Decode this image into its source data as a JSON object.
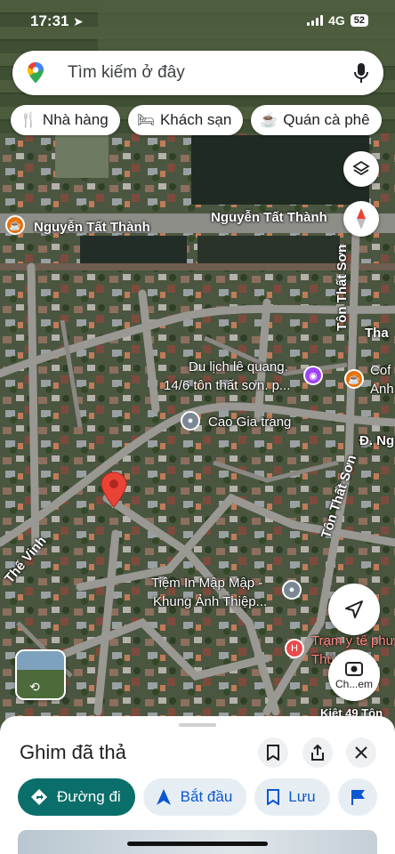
{
  "status_bar": {
    "time": "17:31",
    "network": "4G",
    "battery": "52"
  },
  "search": {
    "placeholder": "Tìm kiếm ở đây"
  },
  "chips": [
    {
      "label": "Nhà hàng",
      "icon": "fork-knife-icon"
    },
    {
      "label": "Khách sạn",
      "icon": "bed-icon"
    },
    {
      "label": "Quán cà phê",
      "icon": "coffee-cup-icon"
    }
  ],
  "map_labels": {
    "street_1": "Nguyễn Tất Thành",
    "street_2": "Nguyễn Tất Thành",
    "street_3": "Tôn Thất Sơn",
    "street_4": "Tôn Thất Sơn",
    "street_5": "Thế Vinh",
    "street_6": "Tha",
    "street_7": "Đ. Ng",
    "poi_1_line1": "Du lịch lê quang.",
    "poi_1_line2": "14/6 tôn thất sơn. p...",
    "poi_2": "Cao Gia trang",
    "poi_3_line1": "Tiệm In Mập Mập -",
    "poi_3_line2": "Khung Ảnh Thiệp...",
    "poi_4_line1": "Trạm y tế phư",
    "poi_4_line2": "Thủ",
    "poi_5": "Cof",
    "poi_5b": "Anh",
    "street_8": "Kiệt 49 Tôn",
    "camera_label": "Ch...em"
  },
  "sheet": {
    "title": "Ghim đã thả",
    "actions": [
      {
        "label": "Đường đi",
        "icon": "directions-icon"
      },
      {
        "label": "Bắt đầu",
        "icon": "navigation-arrow-icon"
      },
      {
        "label": "Lưu",
        "icon": "bookmark-icon"
      }
    ]
  },
  "colors": {
    "accent": "#0a6e6a",
    "pin": "#ea4335",
    "action_bg": "#e6eef4"
  }
}
